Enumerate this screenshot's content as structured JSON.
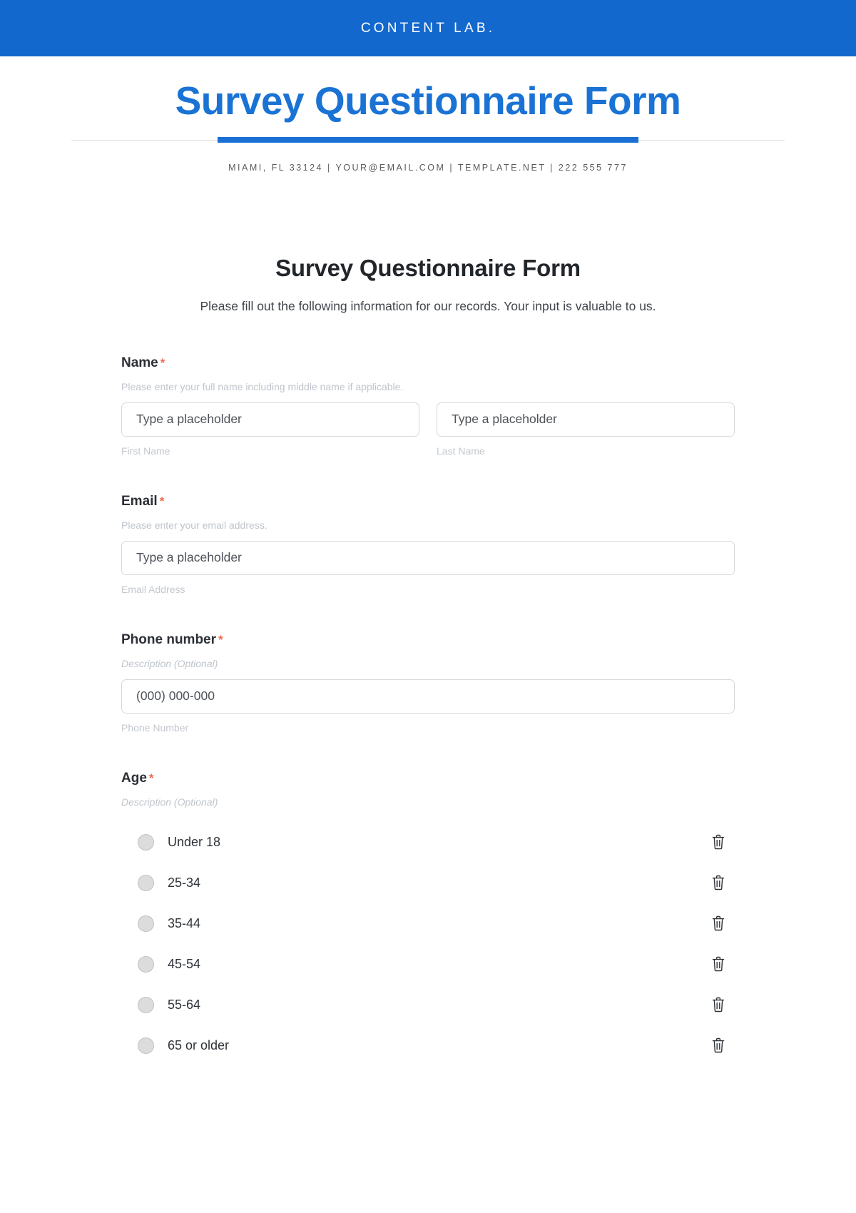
{
  "brand": {
    "name": "CONTENT LAB.",
    "bar_color": "#1368ce"
  },
  "letterhead": {
    "title": "Survey Questionnaire Form",
    "title_color": "#1a73d4",
    "contact": "MIAMI, FL 33124 | YOUR@EMAIL.COM | TEMPLATE.NET | 222 555 777"
  },
  "form": {
    "title": "Survey Questionnaire Form",
    "subtitle": "Please fill out the following information for our records. Your input is valuable to us.",
    "required_marker": "*",
    "fields": {
      "name": {
        "label": "Name",
        "help": "Please enter your full name including middle name if applicable.",
        "first": {
          "placeholder": "Type a placeholder",
          "caption": "First Name"
        },
        "last": {
          "placeholder": "Type a placeholder",
          "caption": "Last Name"
        }
      },
      "email": {
        "label": "Email",
        "help": "Please enter your email address.",
        "placeholder": "Type a placeholder",
        "caption": "Email Address"
      },
      "phone": {
        "label": "Phone number",
        "help": "Description (Optional)",
        "placeholder": "(000) 000-000",
        "caption": "Phone Number"
      },
      "age": {
        "label": "Age",
        "help": "Description (Optional)",
        "options": [
          {
            "label": "Under 18",
            "delete_icon": "trash-icon"
          },
          {
            "label": "25-34",
            "delete_icon": "trash-icon"
          },
          {
            "label": "35-44",
            "delete_icon": "trash-icon"
          },
          {
            "label": "45-54",
            "delete_icon": "trash-icon"
          },
          {
            "label": "55-64",
            "delete_icon": "trash-icon"
          },
          {
            "label": "65 or older",
            "delete_icon": "trash-icon"
          }
        ]
      }
    }
  },
  "colors": {
    "brand_blue": "#1368ce",
    "title_blue": "#1a73d4",
    "required_red": "#f4694e",
    "help_gray": "#bfc5cc",
    "border_gray": "#d4d9de"
  }
}
